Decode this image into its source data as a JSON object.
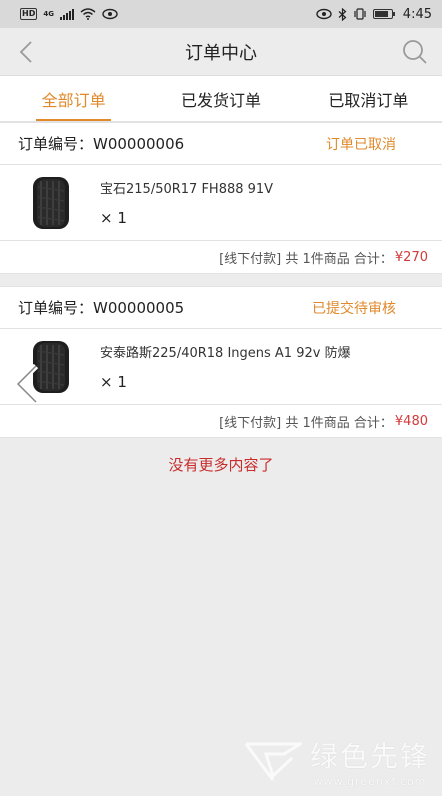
{
  "status_bar": {
    "hd": "HD",
    "network": "4G",
    "time": "4:45",
    "battery_level": 0.8
  },
  "nav": {
    "title": "订单中心",
    "back_icon": "chevron-left-icon",
    "search_icon": "search-icon"
  },
  "tabs": [
    {
      "label": "全部订单",
      "active": true
    },
    {
      "label": "已发货订单",
      "active": false
    },
    {
      "label": "已取消订单",
      "active": false
    }
  ],
  "orders": [
    {
      "order_no": "订单编号：W00000006",
      "status": "订单已取消",
      "item_name": "宝石215/50R17 FH888 91V",
      "qty": "× 1",
      "summary": "[线下付款] 共 1件商品 合计：",
      "total": "¥270"
    },
    {
      "order_no": "订单编号：W00000005",
      "status": "已提交待审核",
      "item_name": "安泰路斯225/40R18 Ingens A1 92v 防爆",
      "qty": "× 1",
      "summary": "[线下付款] 共 1件商品 合计：",
      "total": "¥480"
    }
  ],
  "footer_note": "没有更多内容了",
  "watermark": {
    "title": "绿色先锋",
    "url": "www.greenxf.com"
  },
  "colors": {
    "accent": "#e08a2c",
    "price": "#d23b3b",
    "no_more": "#c82c2c"
  }
}
